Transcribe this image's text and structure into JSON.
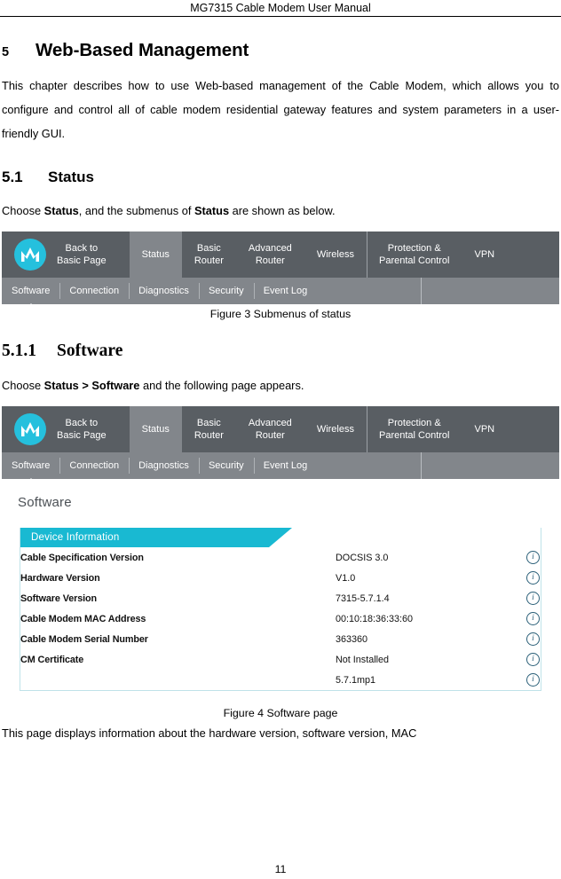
{
  "document": {
    "running_head": "MG7315 Cable Modem User Manual",
    "page_number": "11"
  },
  "chapter": {
    "number": "5",
    "title": "Web-Based Management",
    "intro": "This chapter describes how to use Web-based management of the Cable Modem, which allows you to configure and control all of cable modem residential gateway features and system parameters in a user-friendly GUI."
  },
  "section_status": {
    "number": "5.1",
    "title": "Status",
    "lead_prefix": "Choose ",
    "lead_bold1": "Status",
    "lead_mid": ", and the submenus of ",
    "lead_bold2": "Status",
    "lead_suffix": " are shown as below."
  },
  "figure3": {
    "caption": "Figure 3 Submenus of status"
  },
  "subsection_software": {
    "number": "5.1.1",
    "title": "Software",
    "lead_prefix": "Choose ",
    "lead_bold": "Status > Software",
    "lead_suffix": " and the following page appears."
  },
  "figure4": {
    "caption": "Figure 4 Software page"
  },
  "closing_paragraph": "This page displays information about the hardware version, software version, MAC",
  "ui": {
    "logo_name": "motorola-batwing-logo",
    "logo_color": "#25c0dd",
    "nav_background": "#595e63",
    "subnav_background": "#82868b",
    "accent_color": "#19b9d2",
    "back_line1": "Back to",
    "back_line2": "Basic Page",
    "nav_items": [
      {
        "label": "Status",
        "active": true
      },
      {
        "label": "Basic\nRouter",
        "active": false
      },
      {
        "label": "Advanced\nRouter",
        "active": false
      },
      {
        "label": "Wireless",
        "active": false
      },
      {
        "label": "Protection &\nParental Control",
        "active": false
      },
      {
        "label": "VPN",
        "active": false
      }
    ],
    "subnav_items": [
      {
        "label": "Software",
        "current": true
      },
      {
        "label": "Connection",
        "current": false
      },
      {
        "label": "Diagnostics",
        "current": false
      },
      {
        "label": "Security",
        "current": false
      },
      {
        "label": "Event Log",
        "current": false
      }
    ],
    "page_title": "Software",
    "panel_title": "Device Information",
    "info_icon_name": "info-icon",
    "info_icon_glyph": "i",
    "device_info_rows": [
      {
        "key": "Cable Specification Version",
        "value": "DOCSIS 3.0"
      },
      {
        "key": "Hardware Version",
        "value": "V1.0"
      },
      {
        "key": "Software Version",
        "value": "7315-5.7.1.4"
      },
      {
        "key": "Cable Modem MAC Address",
        "value": "00:10:18:36:33:60"
      },
      {
        "key": "Cable Modem Serial Number",
        "value": "363360"
      },
      {
        "key": "CM Certificate",
        "value": "Not Installed"
      },
      {
        "key": "",
        "value": "5.7.1mp1"
      }
    ]
  }
}
